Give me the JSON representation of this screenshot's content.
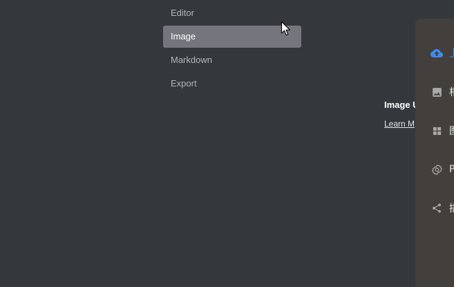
{
  "settings_nav": {
    "items": [
      {
        "label": "Editor",
        "active": false
      },
      {
        "label": "Image",
        "active": true
      },
      {
        "label": "Markdown",
        "active": false
      },
      {
        "label": "Export",
        "active": false
      }
    ]
  },
  "image_uploader": {
    "title": "Image U",
    "learn_more": "Learn M"
  },
  "side_panel": {
    "items": [
      {
        "icon": "cloud-upload-icon",
        "label": "上",
        "active": true
      },
      {
        "icon": "image-icon",
        "label": "相",
        "active": false
      },
      {
        "icon": "grid-icon",
        "label": "图",
        "active": false
      },
      {
        "icon": "gear-icon",
        "label": "P",
        "active": false
      },
      {
        "icon": "share-icon",
        "label": "插",
        "active": false
      }
    ]
  },
  "colors": {
    "background": "#34383d",
    "nav_active": "#75767d",
    "panel_background": "#433f3c",
    "accent": "#3b8cf2"
  }
}
